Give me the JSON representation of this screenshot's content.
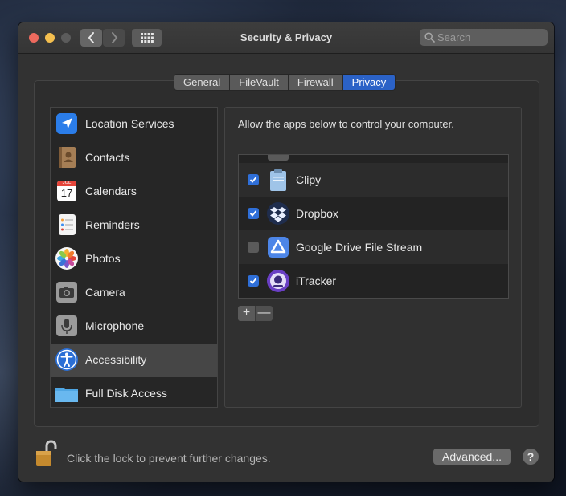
{
  "window": {
    "title": "Security & Privacy",
    "search_placeholder": "Search"
  },
  "tabs": [
    {
      "label": "General",
      "active": false
    },
    {
      "label": "FileVault",
      "active": false
    },
    {
      "label": "Firewall",
      "active": false
    },
    {
      "label": "Privacy",
      "active": true
    }
  ],
  "sidebar": {
    "items": [
      {
        "label": "Location Services",
        "icon": "location-arrow-icon",
        "selected": false
      },
      {
        "label": "Contacts",
        "icon": "contacts-book-icon",
        "selected": false
      },
      {
        "label": "Calendars",
        "icon": "calendar-icon",
        "selected": false
      },
      {
        "label": "Reminders",
        "icon": "reminders-list-icon",
        "selected": false
      },
      {
        "label": "Photos",
        "icon": "photos-flower-icon",
        "selected": false
      },
      {
        "label": "Camera",
        "icon": "camera-icon",
        "selected": false
      },
      {
        "label": "Microphone",
        "icon": "microphone-icon",
        "selected": false
      },
      {
        "label": "Accessibility",
        "icon": "accessibility-icon",
        "selected": true
      },
      {
        "label": "Full Disk Access",
        "icon": "folder-icon",
        "selected": false
      }
    ],
    "calendar_month": "JUL",
    "calendar_day": "17"
  },
  "main": {
    "description": "Allow the apps below to control your computer.",
    "apps": [
      {
        "label": "Clipy",
        "checked": true,
        "icon": "clipy-clipboard-icon"
      },
      {
        "label": "Dropbox",
        "checked": true,
        "icon": "dropbox-icon"
      },
      {
        "label": "Google Drive File Stream",
        "checked": false,
        "icon": "google-drive-icon"
      },
      {
        "label": "iTracker",
        "checked": true,
        "icon": "itracker-icon"
      }
    ],
    "add_label": "+",
    "remove_label": "—"
  },
  "footer": {
    "lock_text": "Click the lock to prevent further changes.",
    "advanced_label": "Advanced...",
    "help_label": "?"
  },
  "colors": {
    "accent": "#2b62c7",
    "checkbox_checked": "#2f6fd8"
  }
}
